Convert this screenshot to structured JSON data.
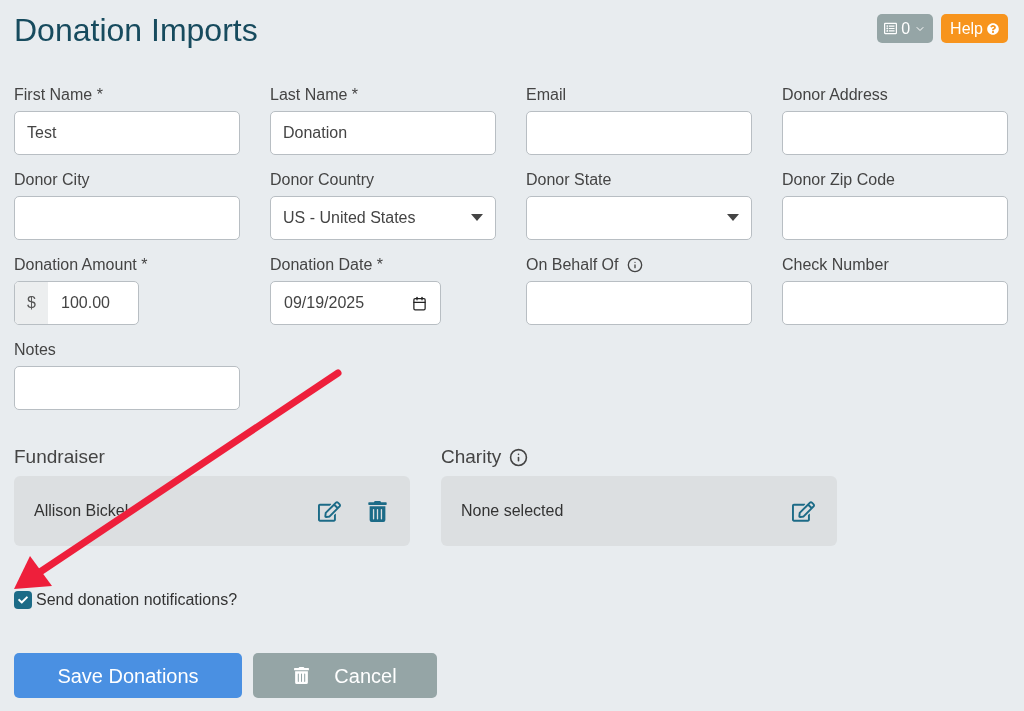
{
  "title": "Donation Imports",
  "header_actions": {
    "count": "0",
    "help": "Help"
  },
  "fields": [
    {
      "label": "First Name *",
      "kind": "text",
      "value": "Test"
    },
    {
      "label": "Last Name *",
      "kind": "text",
      "value": "Donation"
    },
    {
      "label": "Email",
      "kind": "text"
    },
    {
      "label": "Donor Address",
      "kind": "text"
    },
    {
      "label": "Donor City",
      "kind": "text"
    },
    {
      "label": "Donor Country",
      "kind": "select",
      "value": "US - United States"
    },
    {
      "label": "Donor State",
      "kind": "select"
    },
    {
      "label": "Donor Zip Code",
      "kind": "text"
    },
    {
      "label": "Donation Amount *",
      "kind": "currency",
      "prefix": "$",
      "value": "100.00"
    },
    {
      "label": "Donation Date *",
      "kind": "date",
      "value": "09/19/2025"
    },
    {
      "label": "On Behalf Of",
      "kind": "text",
      "info": true
    },
    {
      "label": "Check Number",
      "kind": "text"
    },
    {
      "label": "Notes",
      "kind": "text"
    }
  ],
  "panels": [
    {
      "title": "Fundraiser",
      "info": false,
      "value": "Allison Bickel",
      "deletable": true
    },
    {
      "title": "Charity",
      "info": true,
      "value": "None selected",
      "deletable": false
    }
  ],
  "notify": {
    "label": "Send donation notifications?",
    "checked": true
  },
  "buttons": [
    {
      "label": "Save Donations",
      "kind": "primary"
    },
    {
      "label": "Cancel",
      "kind": "cancel"
    }
  ]
}
